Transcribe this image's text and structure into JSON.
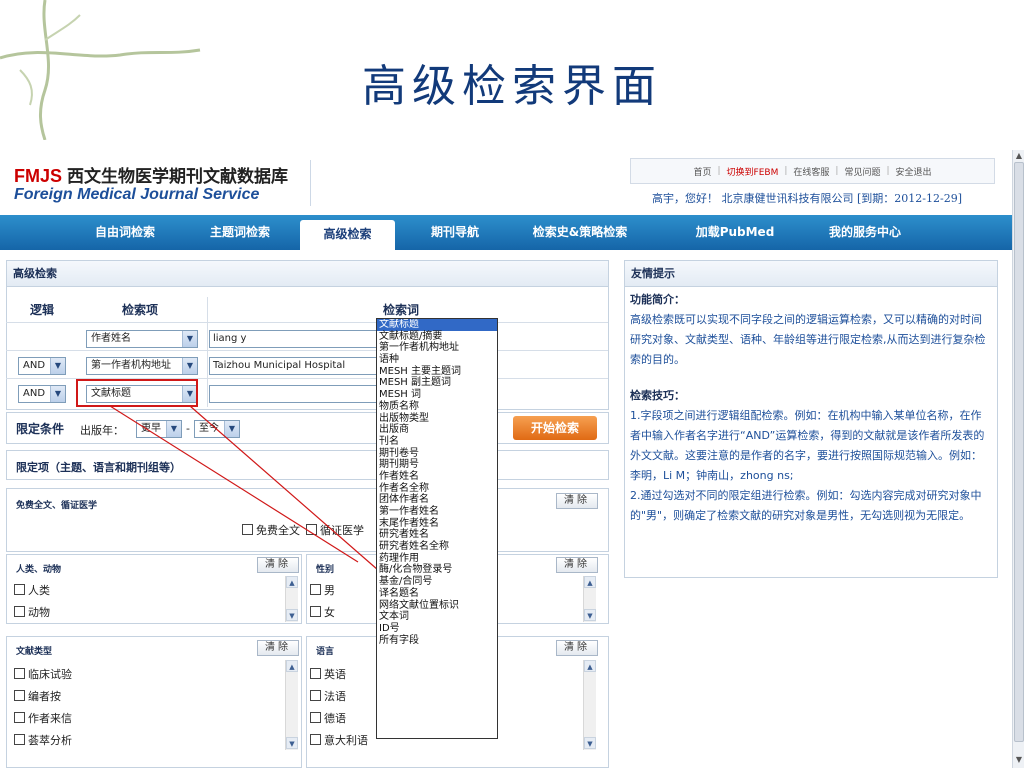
{
  "slide": {
    "title": "高级检索界面"
  },
  "header": {
    "logo_abbr": "FMJS",
    "logo_cn": "西文生物医学期刊文献数据库",
    "logo_en": "Foreign Medical Journal Service",
    "top_links": [
      "首页",
      "切换到FEBM",
      "在线客服",
      "常见问题",
      "安全退出"
    ],
    "user_line": "高宇，您好！ 北京康健世讯科技有限公司 [到期：2012-12-29]"
  },
  "nav": {
    "tabs": [
      "自由词检索",
      "主题词检索",
      "高级检索",
      "期刊导航",
      "检索史&策略检索",
      "加载PubMed",
      "我的服务中心"
    ],
    "active": "高级检索"
  },
  "search": {
    "panel_title": "高级检索",
    "col_logic": "逻辑",
    "col_field": "检索项",
    "col_term": "检索词",
    "rows": [
      {
        "logic": "",
        "field": "作者姓名",
        "term": "liang y"
      },
      {
        "logic": "AND",
        "field": "第一作者机构地址",
        "term": "Taizhou Municipal Hospital"
      },
      {
        "logic": "AND",
        "field": "文献标题",
        "term": ""
      }
    ],
    "limit_label": "限定条件",
    "year_label": "出版年：",
    "year_from": "更早",
    "year_dash": "-",
    "year_to": "至今",
    "go_button": "开始检索",
    "limit_section": "限定项（主题、语言和期刊组等）",
    "clear": "清除",
    "free_group": {
      "title": "免费全文、循证医学",
      "items": [
        "免费全文",
        "循证医学"
      ]
    },
    "species": {
      "title": "人类、动物",
      "items": [
        "人类",
        "动物"
      ]
    },
    "gender": {
      "title": "性别",
      "items": [
        "男",
        "女"
      ]
    },
    "doc_type": {
      "title": "文献类型",
      "items": [
        "临床试验",
        "编者按",
        "作者来信",
        "荟萃分析"
      ]
    },
    "language": {
      "title": "语言",
      "items": [
        "英语",
        "法语",
        "德语",
        "意大利语"
      ]
    },
    "field_options": [
      "文献标题",
      "文献标题/摘要",
      "第一作者机构地址",
      "语种",
      "MESH 主要主题词",
      "MESH 副主题词",
      "MESH 词",
      "物质名称",
      "出版物类型",
      "出版商",
      "刊名",
      "期刊卷号",
      "期刊期号",
      "作者姓名",
      "作者名全称",
      "团体作者名",
      "第一作者姓名",
      "末尾作者姓名",
      "研究者姓名",
      "研究者姓名全称",
      "药理作用",
      "酶/化合物登录号",
      "基金/合同号",
      "译名题名",
      "网络文献位置标识",
      "文本词",
      "ID号",
      "所有字段"
    ]
  },
  "tips": {
    "title": "友情提示",
    "intro_head": "功能简介：",
    "intro": "高级检索既可以实现不同字段之间的逻辑运算检索，又可以精确的对时间研究对象、文献类型、语种、年龄组等进行限定检索,从而达到进行复杂检索的目的。",
    "skill_head": "检索技巧：",
    "skill1": "1.字段项之间进行逻辑组配检索。例如：在机构中输入某单位名称，在作者中输入作者名字进行“AND”运算检索，得到的文献就是该作者所发表的外文文献。这要注意的是作者的名字，要进行按照国际规范输入。例如：李明，Li M；钟南山，zhong ns;",
    "skill2": "2.通过勾选对不同的限定组进行检索。例如：勾选内容完成对研究对象中的\"男\"，则确定了检索文献的研究对象是男性，无勾选则视为无限定。"
  },
  "colors": {
    "nav": "#1d78bb",
    "accent": "#c00000",
    "go": "#e87a22",
    "selection": "#3169c6"
  }
}
